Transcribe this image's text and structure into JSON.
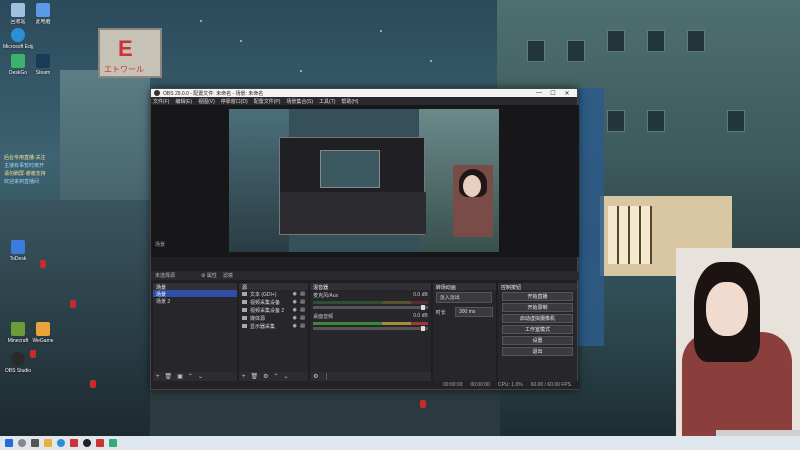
{
  "desktop": {
    "icons": [
      {
        "label": "回收站",
        "color": "#9fc0e0"
      },
      {
        "label": "此电脑",
        "color": "#5a9ae6"
      },
      {
        "label": "Microsoft Edge",
        "color": "#2b8fd6"
      },
      {
        "label": "DeskGo",
        "color": "#3bb36a"
      },
      {
        "label": "Steam",
        "color": "#1b3a5a"
      },
      {
        "label": "ToDesk",
        "color": "#3d7be0"
      },
      {
        "label": "OBS Studio",
        "color": "#2a2a2a"
      },
      {
        "label": "WeGame",
        "color": "#e8a33a"
      },
      {
        "label": "Minecraft",
        "color": "#6a9c3a"
      }
    ],
    "overlay_text": [
      "后台专用直播·关注",
      "主播有事暂时离开",
      "请勿刷屏·谢谢支持",
      "欢迎来到直播间"
    ]
  },
  "obs": {
    "window_title": "OBS 29.0.0 - 配置文件: 未命名 - 场景: 未命名",
    "window_buttons": {
      "min": "—",
      "max": "☐",
      "close": "✕"
    },
    "menu": [
      "文件(F)",
      "编辑(E)",
      "视图(V)",
      "停靠窗口(D)",
      "配置文件(P)",
      "场景集合(S)",
      "工具(T)",
      "帮助(H)"
    ],
    "preview_scene_label": "场景",
    "toolstrip": {
      "scene_name": "未选择源",
      "properties": "⚙ 属性",
      "filters": "滤镜"
    },
    "scenes": {
      "title": "场景",
      "items": [
        "场景",
        "场景 2"
      ],
      "active_index": 0
    },
    "sources": {
      "title": "源",
      "items": [
        "文本 (GDI+)",
        "视频采集设备",
        "视频采集设备 2",
        "媒体源",
        "显示器采集"
      ]
    },
    "mixer": {
      "title": "混音器",
      "channels": [
        {
          "name": "麦克风/Aux",
          "db": "0.0 dB"
        },
        {
          "name": "桌面音频",
          "db": "0.0 dB"
        }
      ]
    },
    "transitions": {
      "title": "转场动画",
      "selected": "淡入淡出",
      "duration_label": "时长",
      "duration": "300 ms"
    },
    "controls": {
      "title": "控制按钮",
      "buttons": [
        "开始直播",
        "开始录制",
        "启动虚拟摄像机",
        "工作室模式",
        "设置",
        "退出"
      ]
    },
    "status": {
      "live_time": "00:00:00",
      "rec_time": "00:00:00",
      "cpu": "CPU: 1.0%",
      "fps": "60.00 / 60.00 FPS"
    }
  }
}
